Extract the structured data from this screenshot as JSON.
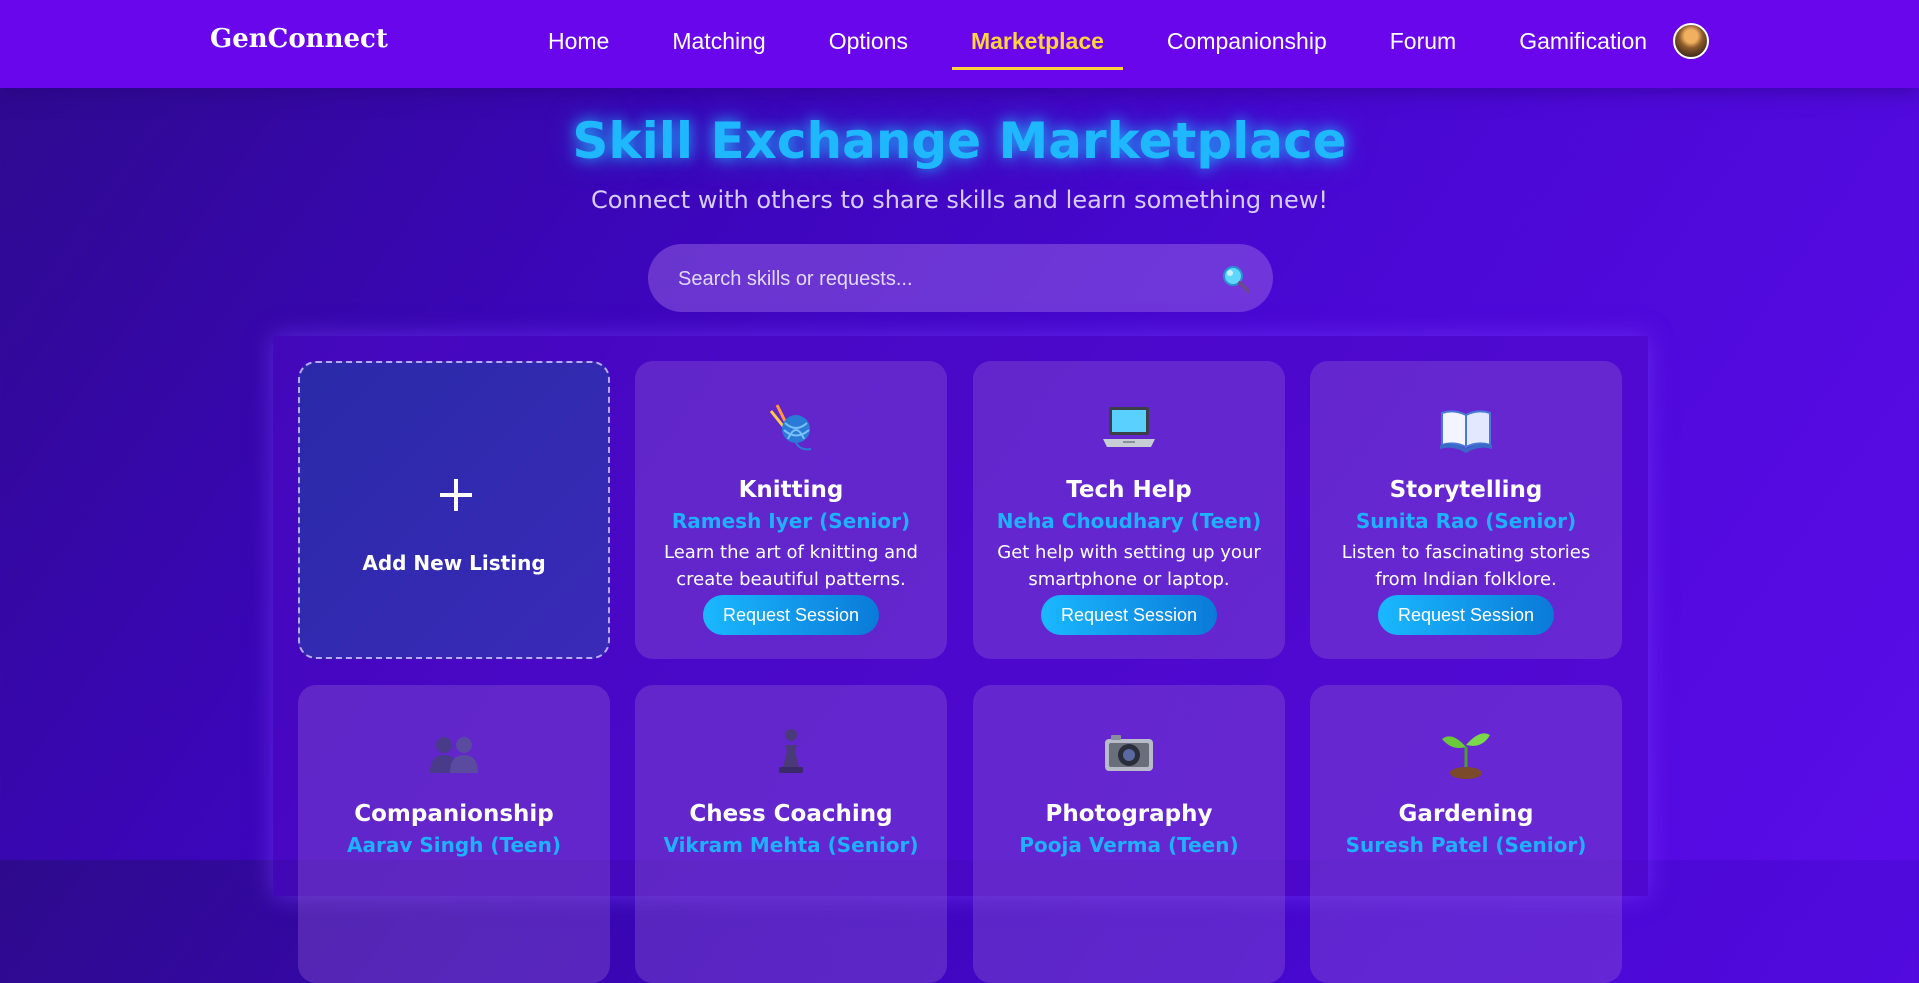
{
  "nav": {
    "logo": "GenConnect",
    "links": [
      "Home",
      "Matching",
      "Options",
      "Marketplace",
      "Companionship",
      "Forum",
      "Gamification"
    ],
    "active": "Marketplace"
  },
  "hero": {
    "title": "Skill Exchange Marketplace",
    "subtitle": "Connect with others to share skills and learn something new!"
  },
  "search": {
    "placeholder": "Search skills or requests..."
  },
  "add_listing": {
    "plus": "+",
    "label": "Add New Listing"
  },
  "listings": [
    {
      "icon": "yarn-icon",
      "title": "Knitting",
      "owner": "Ramesh Iyer (Senior)",
      "desc": "Learn the art of knitting and create beautiful patterns.",
      "button": "Request Session"
    },
    {
      "icon": "laptop-icon",
      "title": "Tech Help",
      "owner": "Neha Choudhary (Teen)",
      "desc": "Get help with setting up your smartphone or laptop.",
      "button": "Request Session"
    },
    {
      "icon": "book-icon",
      "title": "Storytelling",
      "owner": "Sunita Rao (Senior)",
      "desc": "Listen to fascinating stories from Indian folklore.",
      "button": "Request Session"
    },
    {
      "icon": "people-icon",
      "title": "Companionship",
      "owner": "Aarav Singh (Teen)"
    },
    {
      "icon": "chess-pawn-icon",
      "title": "Chess Coaching",
      "owner": "Vikram Mehta (Senior)"
    },
    {
      "icon": "camera-icon",
      "title": "Photography",
      "owner": "Pooja Verma (Teen)"
    },
    {
      "icon": "seedling-icon",
      "title": "Gardening",
      "owner": "Suresh Patel (Senior)"
    }
  ],
  "colors": {
    "nav_bg": "#6a06ec",
    "accent_yellow": "#ffd23f",
    "accent_cyan": "#1fb8ff"
  }
}
